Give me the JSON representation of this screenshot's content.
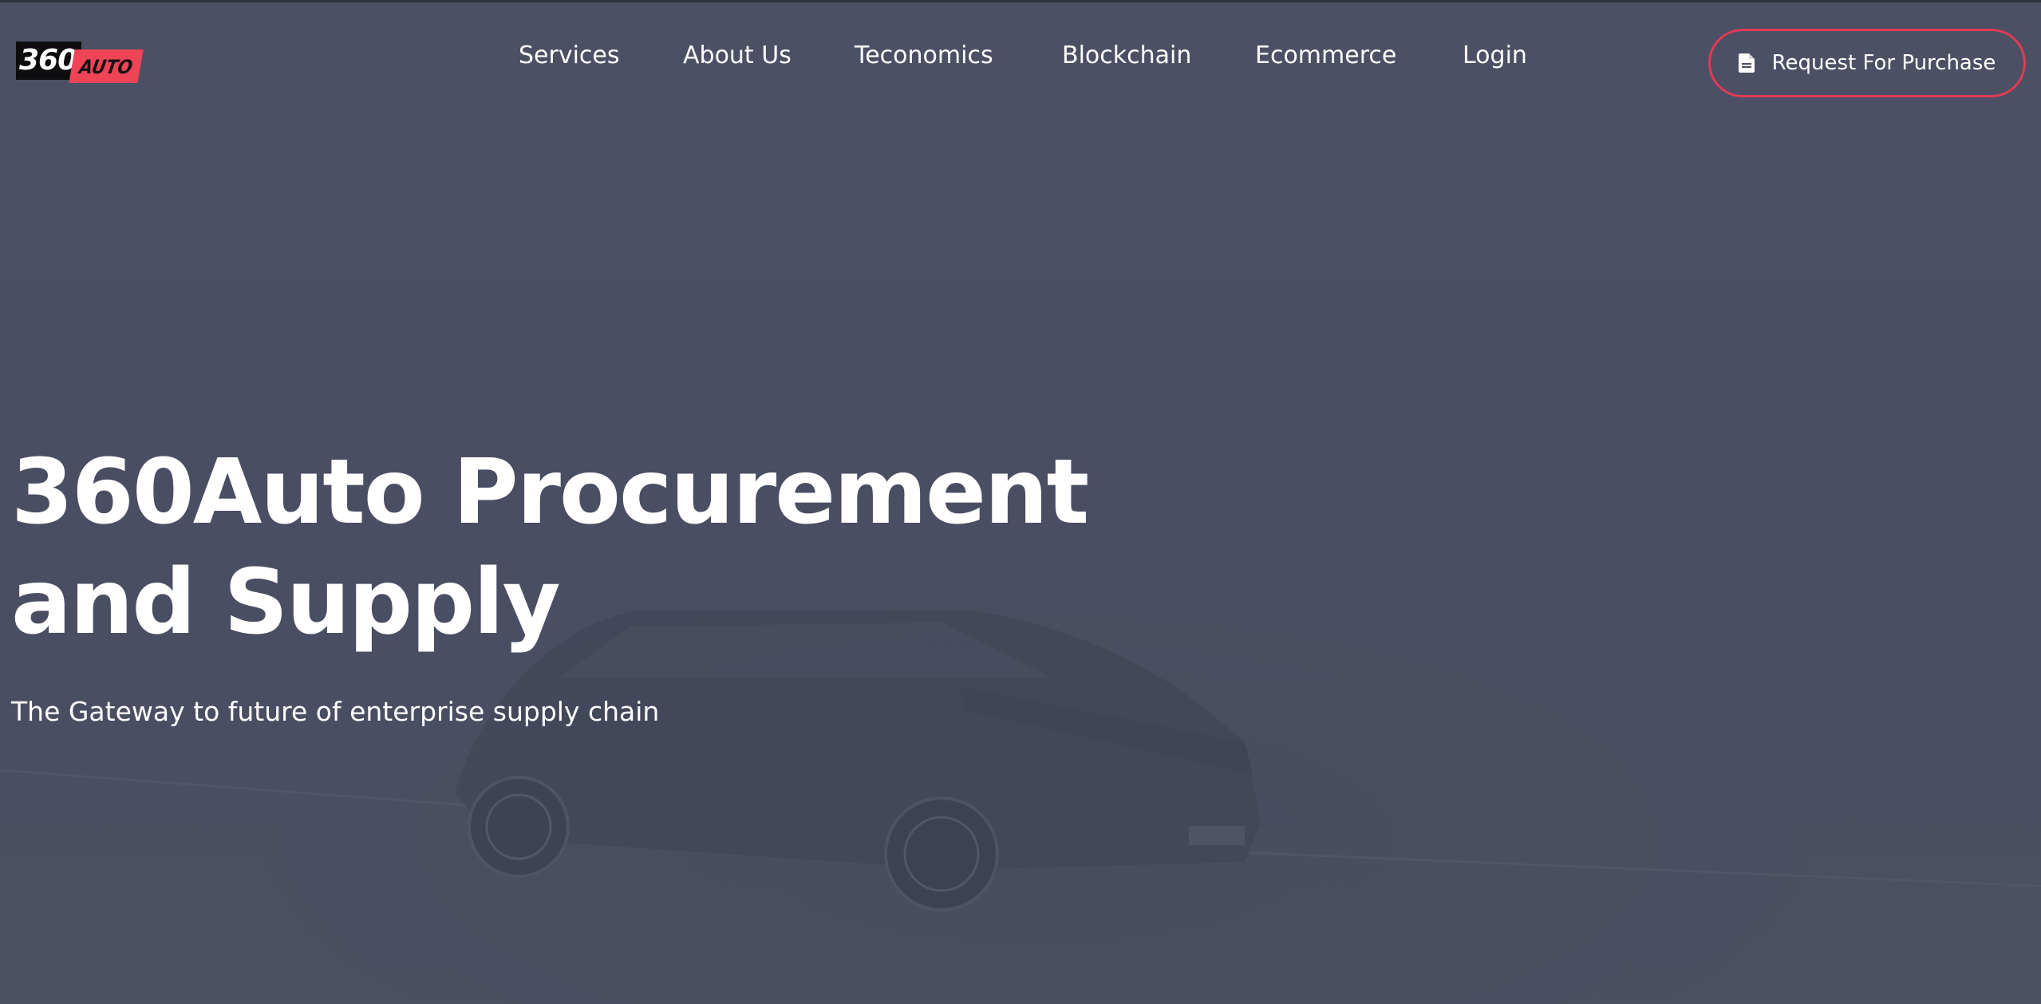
{
  "brand": {
    "logo_number": "360",
    "logo_word": "AUTO"
  },
  "nav": {
    "items": [
      {
        "label": "Services"
      },
      {
        "label": "About Us"
      },
      {
        "label": "Teconomics"
      },
      {
        "label": "Blockchain"
      },
      {
        "label": "Ecommerce"
      },
      {
        "label": "Login"
      }
    ]
  },
  "cta": {
    "label": "Request For Purchase",
    "icon": "document-icon"
  },
  "hero": {
    "title_line1": "360Auto Procurement",
    "title_line2": "and Supply",
    "subtitle": "The Gateway to future of enterprise supply chain"
  },
  "colors": {
    "accent": "#e23a55",
    "logo_red": "#ee4456",
    "overlay": "#4a4e63",
    "text": "#ffffff"
  }
}
